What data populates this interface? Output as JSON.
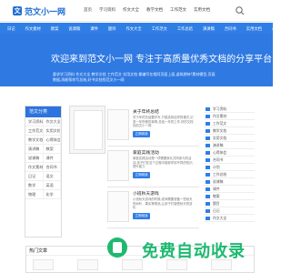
{
  "header": {
    "logo_mark": "文",
    "site_name": "范文小一网",
    "nav": [
      "首页",
      "学习资料",
      "作文大全",
      "教学文档",
      "工作范文",
      "实用文档"
    ]
  },
  "subnav": {
    "items": [
      "日记",
      "作文素材",
      "教案",
      "说课稿",
      "课件",
      "题目",
      "作文大全",
      "工作范文",
      "工作总结",
      "演讲稿",
      "合同书",
      "实用文档",
      "心得体会",
      "计划"
    ]
  },
  "hero": {
    "title": "欢迎来到范文小一网  专注于高质量优秀文档的分享平台",
    "text": "要求学习资料 作文大全 教学文档 工作范文 实用文档 都编写在相同页面上面,虚拟期待!素材模型,页面数据,再能帮你写总结,好书文档找范文小一网"
  },
  "sidebar": {
    "title": "范文分类",
    "items": [
      "学习资料",
      "作文大全",
      "工作范文",
      "实用文档",
      "教学文档",
      "心得体会",
      "演讲稿",
      "教案",
      "说课稿",
      "课件",
      "作文素材",
      "合同书",
      "日记",
      "语文",
      "数学",
      "英语",
      "物理",
      "化学"
    ]
  },
  "posts": [
    {
      "title": "关于年终总结",
      "text": "关于年终总结要好写,只能选择这样的格式,记录一年所做的事情,总结一年的工作,好的文档找范文小一网",
      "button": "立即阅读"
    },
    {
      "title": "家庭实践活动",
      "text": "家庭实践活动是一项需要家长共同参与的活动,孩子们在这个过程中能够学到不同的知识,提升能力",
      "button": "立即阅读"
    },
    {
      "title": "小班秋天游戏",
      "text": "小班秋天游戏的时候,老师需要准备一些秋天的树叶、果实等物品,让孩子们感受秋天的变化",
      "button": "立即阅读"
    }
  ],
  "right_list": {
    "items": [
      "学习资料",
      "作文素材",
      "工作范文",
      "教学文档",
      "实用文档",
      "演讲稿",
      "心得体会",
      "合同书",
      "计划",
      "工作总结",
      "说课稿",
      "课件",
      "教案",
      "题目",
      "日记",
      "作文大全"
    ]
  },
  "hot": {
    "title": "热门文章"
  },
  "watermark": {
    "text": "免费自动收录"
  }
}
